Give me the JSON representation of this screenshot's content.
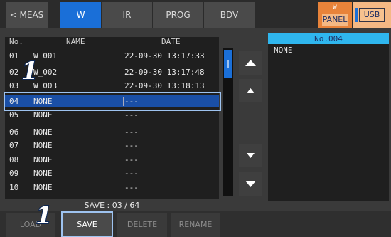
{
  "tabs": [
    {
      "label": "< MEAS"
    },
    {
      "label": "W"
    },
    {
      "label": "IR"
    },
    {
      "label": "PROG"
    },
    {
      "label": "BDV"
    }
  ],
  "panel_button": {
    "top": "W",
    "label": "PANEL"
  },
  "usb_button": {
    "label": "USB"
  },
  "table": {
    "headers": {
      "no": "No.",
      "name": "NAME",
      "date": "DATE"
    },
    "rows": [
      {
        "no": "01",
        "name": "W_001",
        "date": "22-09-30 13:17:33"
      },
      {
        "no": "02",
        "name": "W_002",
        "date": "22-09-30 13:17:48"
      },
      {
        "no": "03",
        "name": "W_003",
        "date": "22-09-30 13:18:13"
      },
      {
        "no": "04",
        "name": "NONE",
        "date": "---"
      },
      {
        "no": "05",
        "name": "NONE",
        "date": "---"
      },
      {
        "no": "06",
        "name": "NONE",
        "date": "---"
      },
      {
        "no": "07",
        "name": "NONE",
        "date": "---"
      },
      {
        "no": "08",
        "name": "NONE",
        "date": "---"
      },
      {
        "no": "09",
        "name": "NONE",
        "date": "---"
      },
      {
        "no": "10",
        "name": "NONE",
        "date": "---"
      }
    ]
  },
  "detail": {
    "title": "No.004",
    "value": "NONE"
  },
  "save_info": "SAVE : 03 / 64",
  "buttons": {
    "load": "LOAD",
    "save": "SAVE",
    "delete": "DELETE",
    "rename": "RENAME"
  },
  "callouts": [
    "1",
    "1"
  ],
  "colors": {
    "accent": "#1a6fd8",
    "highlight": "#2fb6ee",
    "panel": "#e8833a"
  }
}
